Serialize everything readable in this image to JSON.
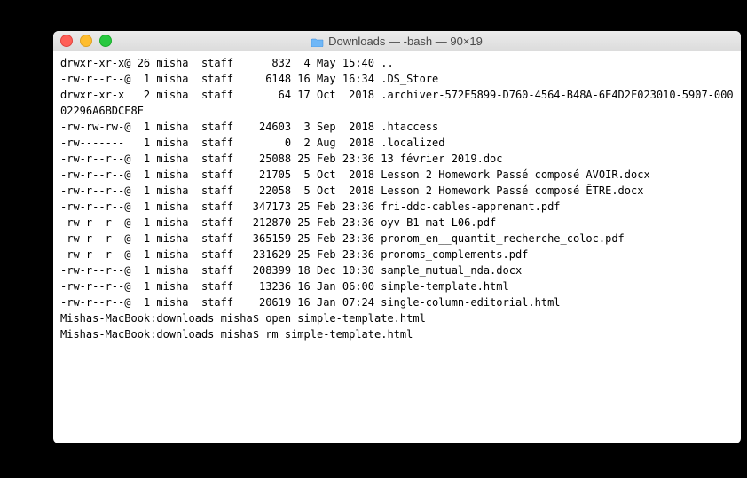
{
  "window": {
    "title": "Downloads — -bash — 90×19"
  },
  "listing": [
    {
      "perm": "drwxr-xr-x@",
      "links": "26",
      "user": "misha",
      "group": "staff",
      "size": "832",
      "date": " 4 May 15:40",
      "name": ".."
    },
    {
      "perm": "-rw-r--r--@",
      "links": " 1",
      "user": "misha",
      "group": "staff",
      "size": "6148",
      "date": "16 May 16:34",
      "name": ".DS_Store"
    },
    {
      "perm": "drwxr-xr-x ",
      "links": " 2",
      "user": "misha",
      "group": "staff",
      "size": "64",
      "date": "17 Oct  2018",
      "name": ".archiver-572F5899-D760-4564-B48A-6E4D2F023010-5907-00002296A6BDCE8E",
      "wrap": true
    },
    {
      "perm": "-rw-rw-rw-@",
      "links": " 1",
      "user": "misha",
      "group": "staff",
      "size": "24603",
      "date": " 3 Sep  2018",
      "name": ".htaccess"
    },
    {
      "perm": "-rw------- ",
      "links": " 1",
      "user": "misha",
      "group": "staff",
      "size": "0",
      "date": " 2 Aug  2018",
      "name": ".localized"
    },
    {
      "perm": "-rw-r--r--@",
      "links": " 1",
      "user": "misha",
      "group": "staff",
      "size": "25088",
      "date": "25 Feb 23:36",
      "name": "13 février 2019.doc"
    },
    {
      "perm": "-rw-r--r--@",
      "links": " 1",
      "user": "misha",
      "group": "staff",
      "size": "21705",
      "date": " 5 Oct  2018",
      "name": "Lesson 2 Homework Passé composé AVOIR.docx",
      "wrap": true
    },
    {
      "perm": "-rw-r--r--@",
      "links": " 1",
      "user": "misha",
      "group": "staff",
      "size": "22058",
      "date": " 5 Oct  2018",
      "name": "Lesson 2 Homework Passé composé ÊTRE.docx"
    },
    {
      "perm": "-rw-r--r--@",
      "links": " 1",
      "user": "misha",
      "group": "staff",
      "size": "347173",
      "date": "25 Feb 23:36",
      "name": "fri-ddc-cables-apprenant.pdf"
    },
    {
      "perm": "-rw-r--r--@",
      "links": " 1",
      "user": "misha",
      "group": "staff",
      "size": "212870",
      "date": "25 Feb 23:36",
      "name": "oyv-B1-mat-L06.pdf"
    },
    {
      "perm": "-rw-r--r--@",
      "links": " 1",
      "user": "misha",
      "group": "staff",
      "size": "365159",
      "date": "25 Feb 23:36",
      "name": "pronom_en__quantit_recherche_coloc.pdf"
    },
    {
      "perm": "-rw-r--r--@",
      "links": " 1",
      "user": "misha",
      "group": "staff",
      "size": "231629",
      "date": "25 Feb 23:36",
      "name": "pronoms_complements.pdf"
    },
    {
      "perm": "-rw-r--r--@",
      "links": " 1",
      "user": "misha",
      "group": "staff",
      "size": "208399",
      "date": "18 Dec 10:30",
      "name": "sample_mutual_nda.docx"
    },
    {
      "perm": "-rw-r--r--@",
      "links": " 1",
      "user": "misha",
      "group": "staff",
      "size": "13236",
      "date": "16 Jan 06:00",
      "name": "simple-template.html"
    },
    {
      "perm": "-rw-r--r--@",
      "links": " 1",
      "user": "misha",
      "group": "staff",
      "size": "20619",
      "date": "16 Jan 07:24",
      "name": "single-column-editorial.html"
    }
  ],
  "prompt_lines": [
    {
      "prompt": "Mishas-MacBook:downloads misha$ ",
      "cmd": "open simple-template.html"
    },
    {
      "prompt": "Mishas-MacBook:downloads misha$ ",
      "cmd": "rm simple-template.html",
      "cursor": true
    }
  ]
}
